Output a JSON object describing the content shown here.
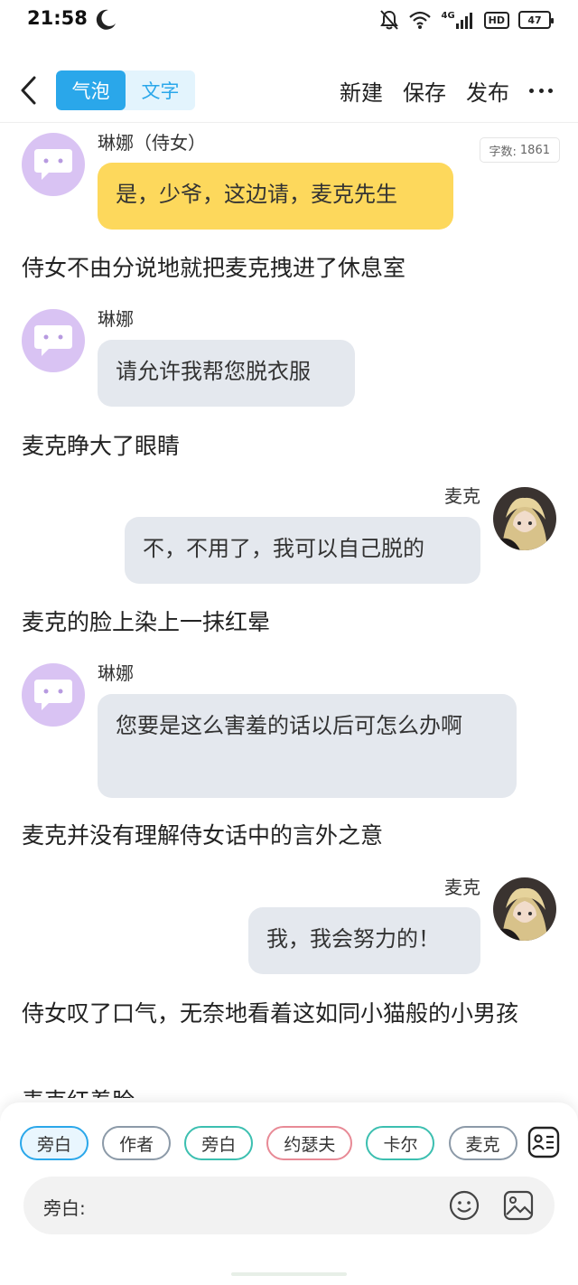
{
  "status_bar": {
    "time": "21:58",
    "network": "4G",
    "hd": "HD",
    "battery": "47"
  },
  "header": {
    "tabs": [
      {
        "label": "气泡",
        "active": true
      },
      {
        "label": "文字",
        "active": false
      }
    ],
    "actions": {
      "new": "新建",
      "save": "保存",
      "publish": "发布"
    }
  },
  "word_count": {
    "label": "字数:",
    "value": "1861"
  },
  "messages": [
    {
      "type": "bubble",
      "side": "left",
      "speaker": "琳娜（侍女）",
      "text": "是，少爷，这边请，麦克先生",
      "color": "#fdd85c"
    },
    {
      "type": "narration",
      "text": "侍女不由分说地就把麦克拽进了休息室"
    },
    {
      "type": "bubble",
      "side": "left",
      "speaker": "琳娜",
      "text": "请允许我帮您脱衣服"
    },
    {
      "type": "narration",
      "text": "麦克睁大了眼睛"
    },
    {
      "type": "bubble",
      "side": "right",
      "speaker": "麦克",
      "text": "不，不用了，我可以自己脱的"
    },
    {
      "type": "narration",
      "text": "麦克的脸上染上一抹红晕"
    },
    {
      "type": "bubble",
      "side": "left",
      "speaker": "琳娜",
      "text": "您要是这么害羞的话以后可怎么办啊"
    },
    {
      "type": "narration",
      "text": "麦克并没有理解侍女话中的言外之意"
    },
    {
      "type": "bubble",
      "side": "right",
      "speaker": "麦克",
      "text": "我，我会努力的！"
    },
    {
      "type": "narration",
      "text": "侍女叹了口气，无奈地看着这如同小猫般的小男孩"
    },
    {
      "type": "narration",
      "text": "麦克红着脸"
    }
  ],
  "roles": [
    {
      "label": "旁白",
      "border": "#2aa7ea",
      "selected": true
    },
    {
      "label": "作者",
      "border": "#8c9aa8",
      "selected": false
    },
    {
      "label": "旁白",
      "border": "#3cbfb0",
      "selected": false
    },
    {
      "label": "约瑟夫",
      "border": "#e88a96",
      "selected": false
    },
    {
      "label": "卡尔",
      "border": "#3cbfb0",
      "selected": false
    },
    {
      "label": "麦克",
      "border": "#8c9aa8",
      "selected": false
    }
  ],
  "input": {
    "label": "旁白:",
    "value": "",
    "placeholder": ""
  },
  "colors": {
    "accent": "#2aa7ea",
    "bubble_gray": "#e4e8ee",
    "bubble_yellow": "#fdd85c",
    "avatar_purple": "#d9c3f3"
  },
  "icons": [
    "back-arrow-icon",
    "moon-icon",
    "mute-bell-icon",
    "wifi-icon",
    "signal-icon",
    "more-dots-icon",
    "chat-bot-avatar-icon",
    "cast-list-icon",
    "emoji-icon",
    "image-icon"
  ]
}
